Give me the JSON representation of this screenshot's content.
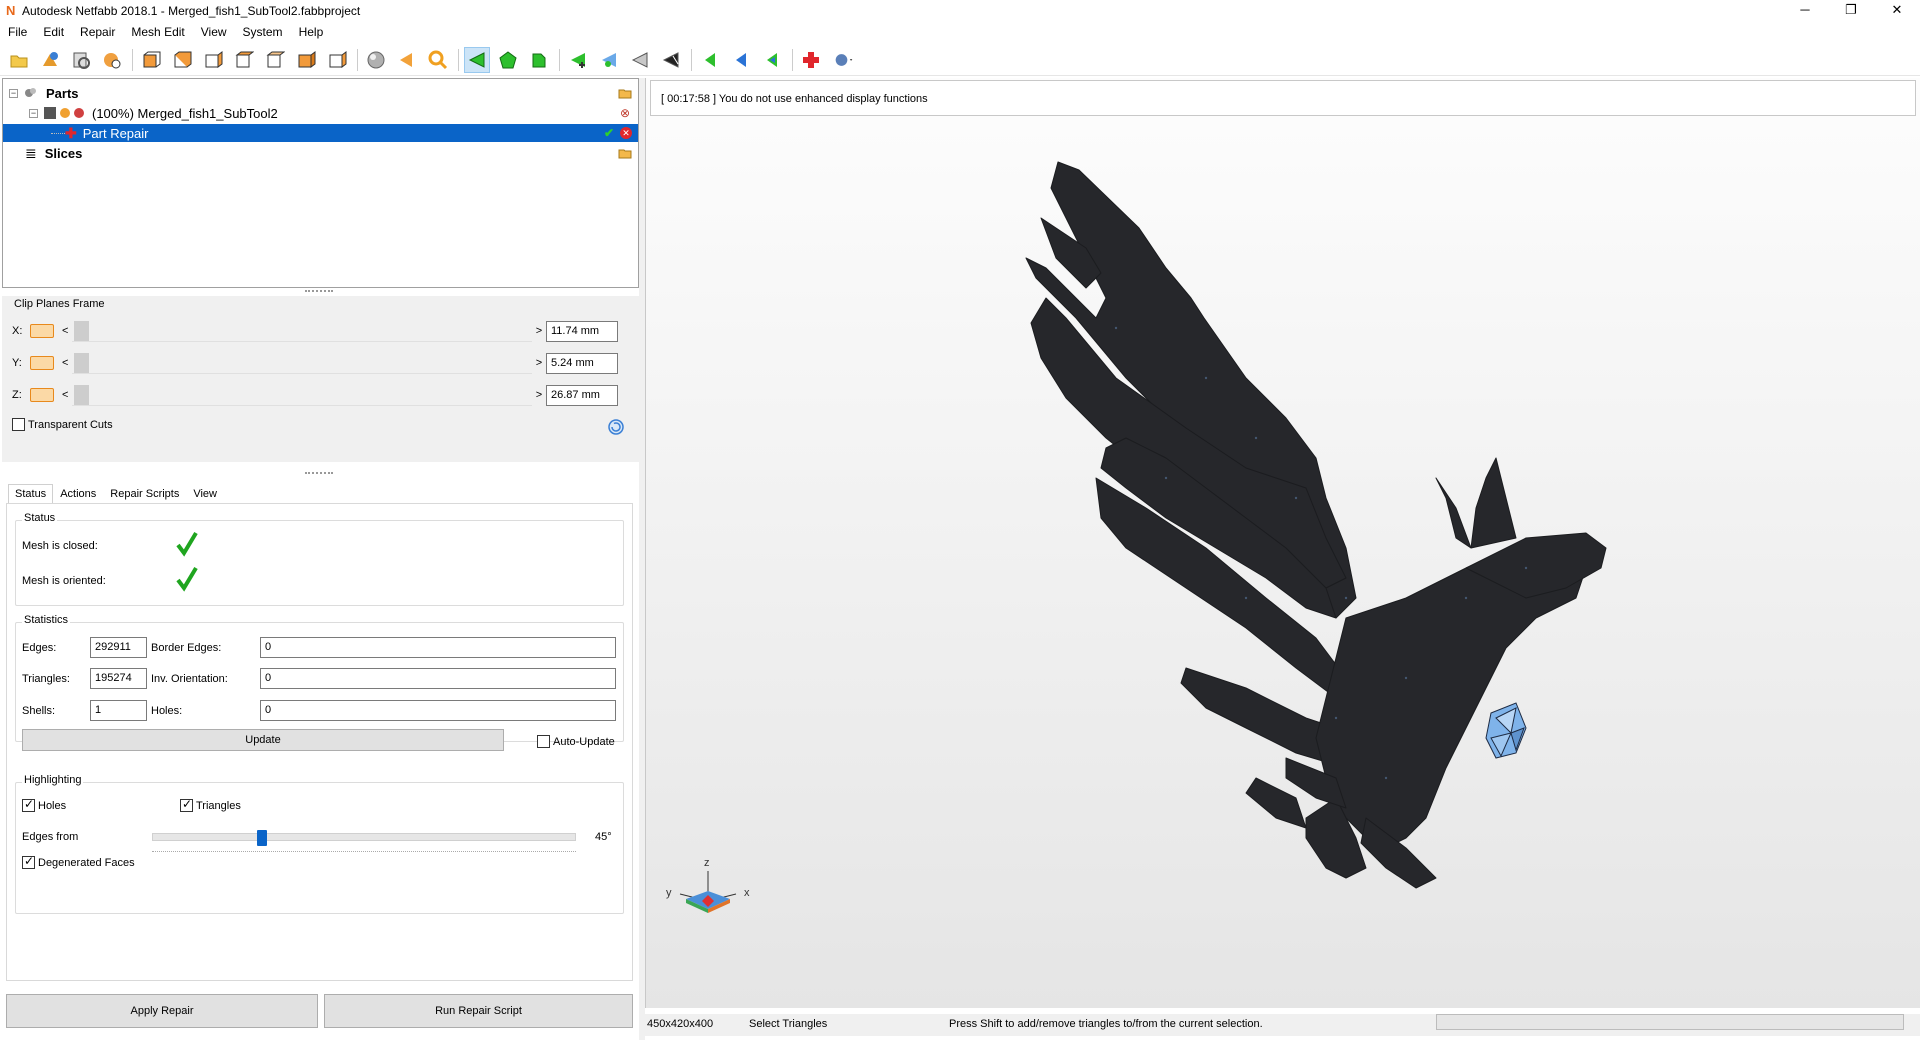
{
  "window": {
    "title": "Autodesk Netfabb 2018.1 - Merged_fish1_SubTool2.fabbproject",
    "controls": {
      "minimize": "─",
      "restore": "❐",
      "close": "✕"
    }
  },
  "menu": [
    "File",
    "Edit",
    "Repair",
    "Mesh Edit",
    "View",
    "System",
    "Help"
  ],
  "tree": {
    "parts": "Parts",
    "part": "(100%) Merged_fish1_SubTool2",
    "repair": "Part Repair",
    "slices": "Slices"
  },
  "clip": {
    "title": "Clip Planes Frame",
    "x_label": "X:",
    "x_value": "11.74 mm",
    "y_label": "Y:",
    "y_value": "5.24 mm",
    "z_label": "Z:",
    "z_value": "26.87 mm",
    "transparent_cuts": "Transparent Cuts",
    "left_arrow": "<",
    "right_arrow": ">"
  },
  "tabs": [
    "Status",
    "Actions",
    "Repair Scripts",
    "View"
  ],
  "status": {
    "group": "Status",
    "mesh_closed": "Mesh is closed:",
    "mesh_oriented": "Mesh is oriented:"
  },
  "statistics": {
    "group": "Statistics",
    "edges_label": "Edges:",
    "edges": "292911",
    "border_edges_label": "Border Edges:",
    "border_edges": "0",
    "triangles_label": "Triangles:",
    "triangles": "195274",
    "inv_orientation_label": "Inv. Orientation:",
    "inv_orientation": "0",
    "shells_label": "Shells:",
    "shells": "1",
    "holes_label": "Holes:",
    "holes": "0",
    "update": "Update",
    "auto_update": "Auto-Update"
  },
  "highlighting": {
    "group": "Highlighting",
    "holes": "Holes",
    "triangles": "Triangles",
    "edges_from": "Edges from",
    "edges_angle": "45°",
    "edges_fraction": 0.25,
    "degenerated": "Degenerated Faces"
  },
  "buttons": {
    "apply_repair": "Apply Repair",
    "run_script": "Run Repair Script"
  },
  "viewport": {
    "log": "[ 00:17:58 ] You do not use enhanced display functions",
    "axis_z": "z",
    "axis_y": "y",
    "axis_x": "x"
  },
  "statusbar": {
    "dimensions": "450x420x400",
    "mode": "Select Triangles",
    "hint": "Press Shift to add/remove triangles to/from the current selection."
  },
  "colors": {
    "selection": "#0a64c8",
    "accent_orange": "#e8891c",
    "check_green": "#1fa51f"
  }
}
